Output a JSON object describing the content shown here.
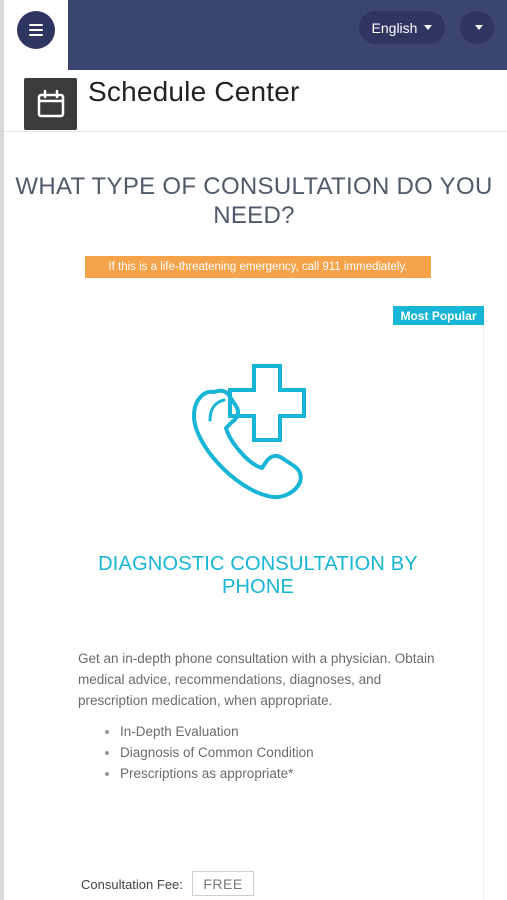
{
  "topbar": {
    "language_label": "English",
    "menu_icon": "hamburger-icon",
    "dropdown_icon": "chevron-down-icon"
  },
  "header": {
    "title": "Schedule Center",
    "icon": "calendar-icon"
  },
  "main": {
    "heading": "WHAT TYPE OF CONSULTATION DO YOU NEED?",
    "alert": "If this is a life-threatening emergency, call 911 immediately."
  },
  "card": {
    "badge": "Most Popular",
    "icon": "phone-plus-icon",
    "title": "DIAGNOSTIC CONSULTATION BY PHONE",
    "description": "Get an in-depth phone consultation with a physician. Obtain medical advice, recommendations, diagnoses, and prescription medication, when appropriate.",
    "features": [
      "In-Depth Evaluation",
      "Diagnosis of Common Condition",
      "Prescriptions as appropriate*"
    ],
    "fee_label": "Consultation Fee:",
    "fee_value": "FREE"
  },
  "colors": {
    "nav": "#3c4470",
    "accent": "#17b5d6",
    "alert": "#f5a34b"
  }
}
